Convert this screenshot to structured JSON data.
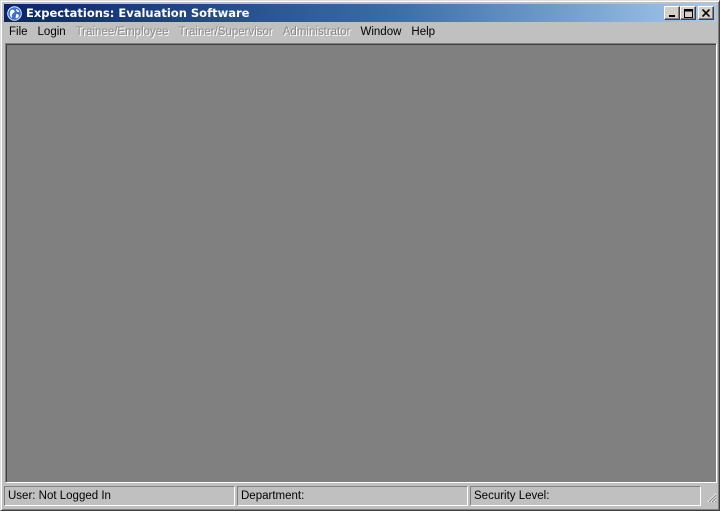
{
  "window": {
    "title": "Expectations: Evaluation Software",
    "icon": "globe-icon",
    "controls": {
      "minimize": "minimize-icon",
      "maximize": "maximize-icon",
      "close": "close-icon"
    }
  },
  "menu": {
    "items": [
      {
        "label": "File",
        "enabled": true
      },
      {
        "label": "Login",
        "enabled": true
      },
      {
        "label": "Trainee/Employee",
        "enabled": false
      },
      {
        "label": "Trainer/Supervisor",
        "enabled": false
      },
      {
        "label": "Administrator",
        "enabled": false
      },
      {
        "label": "Window",
        "enabled": true
      },
      {
        "label": "Help",
        "enabled": true
      }
    ]
  },
  "status": {
    "user": "User: Not Logged In",
    "department": "Department:",
    "security": "Security Level:"
  },
  "colors": {
    "title_gradient_start": "#0a246a",
    "title_gradient_end": "#a6caf0",
    "client_background": "#808080",
    "chrome": "#c0c0c0",
    "disabled_text": "#8a8a8a"
  }
}
